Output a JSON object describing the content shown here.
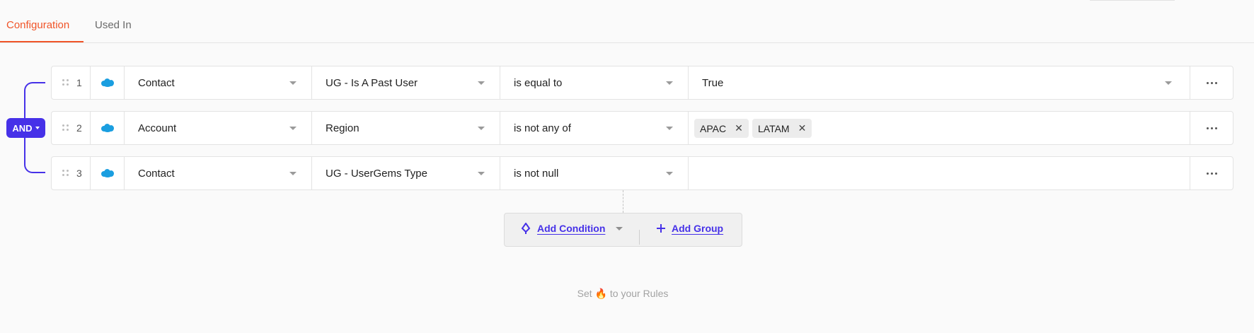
{
  "tabs": [
    {
      "label": "Configuration",
      "active": true
    },
    {
      "label": "Used In",
      "active": false
    }
  ],
  "group": {
    "operator": "AND"
  },
  "icons": {
    "row_source": "salesforce-cloud-icon",
    "drag": "drag-handle-icon",
    "more": "more-horizontal-icon",
    "add_condition": "condition-icon",
    "add_group": "plus-icon"
  },
  "colors": {
    "accent": "#4631e8",
    "tab_active": "#f05428",
    "cloud": "#1a9ee0"
  },
  "rules": [
    {
      "number": "1",
      "object": "Contact",
      "field": "UG - Is A Past User",
      "operator": "is equal to",
      "value": "True"
    },
    {
      "number": "2",
      "object": "Account",
      "field": "Region",
      "operator": "is not any of",
      "values": [
        "APAC",
        "LATAM"
      ]
    },
    {
      "number": "3",
      "object": "Contact",
      "field": "UG - UserGems Type",
      "operator": "is not null",
      "value": ""
    }
  ],
  "actions": {
    "add_condition": "Add Condition",
    "add_group": "Add Group"
  },
  "footer": {
    "before": "Set",
    "emoji": "🔥",
    "after": "to your Rules"
  }
}
